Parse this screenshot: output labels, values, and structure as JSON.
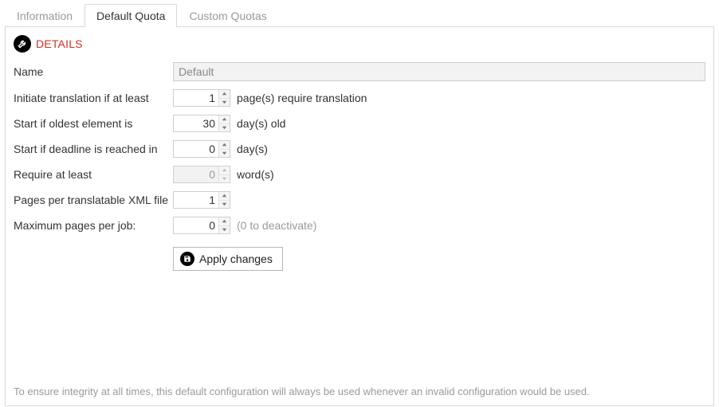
{
  "tabs": [
    {
      "label": "Information",
      "active": false
    },
    {
      "label": "Default Quota",
      "active": true
    },
    {
      "label": "Custom Quotas",
      "active": false
    }
  ],
  "details": {
    "title": "DETAILS"
  },
  "form": {
    "name": {
      "label": "Name",
      "value": "Default",
      "disabled": true
    },
    "initiate": {
      "label": "Initiate translation if at least",
      "value": "1",
      "suffix": "page(s) require translation"
    },
    "oldest": {
      "label": "Start if oldest element  is",
      "value": "30",
      "suffix": "day(s) old"
    },
    "deadline": {
      "label": "Start if deadline is reached in",
      "value": "0",
      "suffix": "day(s)"
    },
    "words": {
      "label": "Require at least",
      "value": "0",
      "suffix": "word(s)",
      "disabled": true
    },
    "ppx": {
      "label": "Pages per translatable XML file",
      "value": "1"
    },
    "maxjob": {
      "label": "Maximum pages per job:",
      "value": "0",
      "suffix": "(0 to deactivate)",
      "suffix_muted": true
    },
    "apply": {
      "label": "Apply changes"
    }
  },
  "footer": "To ensure integrity at all times, this default configuration will always be used whenever an invalid configuration would be used."
}
